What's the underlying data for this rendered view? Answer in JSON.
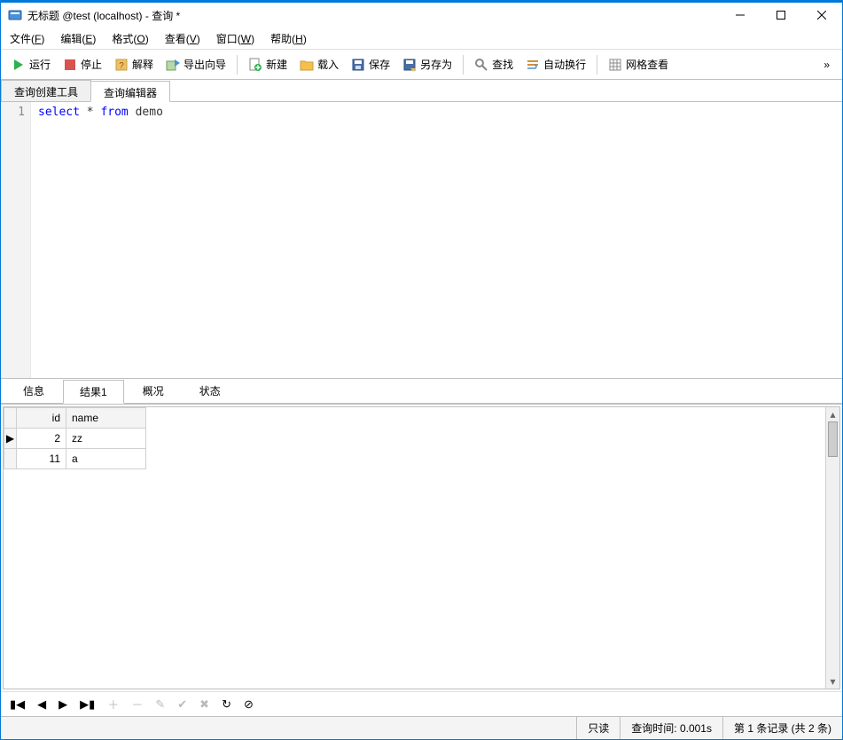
{
  "window": {
    "title": "无标题 @test (localhost) - 查询 *"
  },
  "menubar": [
    {
      "label": "文件",
      "mnemonic": "F"
    },
    {
      "label": "编辑",
      "mnemonic": "E"
    },
    {
      "label": "格式",
      "mnemonic": "O"
    },
    {
      "label": "查看",
      "mnemonic": "V"
    },
    {
      "label": "窗口",
      "mnemonic": "W"
    },
    {
      "label": "帮助",
      "mnemonic": "H"
    }
  ],
  "toolbar": {
    "run": "运行",
    "stop": "停止",
    "explain": "解释",
    "export": "导出向导",
    "new": "新建",
    "load": "载入",
    "save": "保存",
    "saveas": "另存为",
    "find": "查找",
    "wrap": "自动换行",
    "gridview": "网格查看"
  },
  "editor_tabs": {
    "builder": "查询创建工具",
    "editor": "查询编辑器"
  },
  "sql": {
    "line": "1",
    "kw1": "select",
    "star": "*",
    "kw2": "from",
    "tbl": "demo"
  },
  "result_tabs": {
    "info": "信息",
    "result": "结果1",
    "profile": "概况",
    "status": "状态"
  },
  "grid": {
    "columns": [
      "id",
      "name"
    ],
    "rows": [
      {
        "id": "2",
        "name": "zz"
      },
      {
        "id": "11",
        "name": "a"
      }
    ]
  },
  "statusbar": {
    "readonly": "只读",
    "query_time": "查询时间: 0.001s",
    "record": "第 1 条记录 (共 2 条)"
  }
}
